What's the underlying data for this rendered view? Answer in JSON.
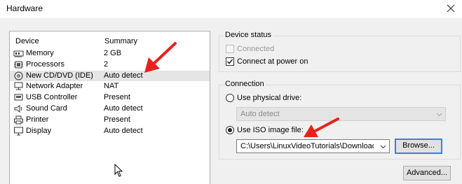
{
  "window": {
    "title": "Hardware"
  },
  "device_list": {
    "columns": {
      "device": "Device",
      "summary": "Summary"
    },
    "rows": [
      {
        "icon": "memory-icon",
        "name": "Memory",
        "summary": "2 GB"
      },
      {
        "icon": "processor-icon",
        "name": "Processors",
        "summary": "2"
      },
      {
        "icon": "cd-dvd-icon",
        "name": "New CD/DVD (IDE)",
        "summary": "Auto detect"
      },
      {
        "icon": "network-adapter-icon",
        "name": "Network Adapter",
        "summary": "NAT"
      },
      {
        "icon": "usb-icon",
        "name": "USB Controller",
        "summary": "Present"
      },
      {
        "icon": "sound-icon",
        "name": "Sound Card",
        "summary": "Auto detect"
      },
      {
        "icon": "printer-icon",
        "name": "Printer",
        "summary": "Present"
      },
      {
        "icon": "display-icon",
        "name": "Display",
        "summary": "Auto detect"
      }
    ]
  },
  "device_status": {
    "label": "Device status",
    "connected_label": "Connected",
    "connected_checked": false,
    "connect_at_power_on_label": "Connect at power on",
    "connect_at_power_on_checked": true
  },
  "connection": {
    "label": "Connection",
    "physical_drive_label": "Use physical drive:",
    "physical_drive_value": "Auto detect",
    "iso_label": "Use ISO image file:",
    "iso_path": "C:\\Users\\LinuxVideoTutorials\\Downloads\\P",
    "browse_label": "Browse...",
    "selected": "iso"
  },
  "advanced_label": "Advanced...",
  "colors": {
    "arrow": "#e8211d",
    "focus": "#3c7fd6",
    "selected_row": "#e5e5e5"
  }
}
